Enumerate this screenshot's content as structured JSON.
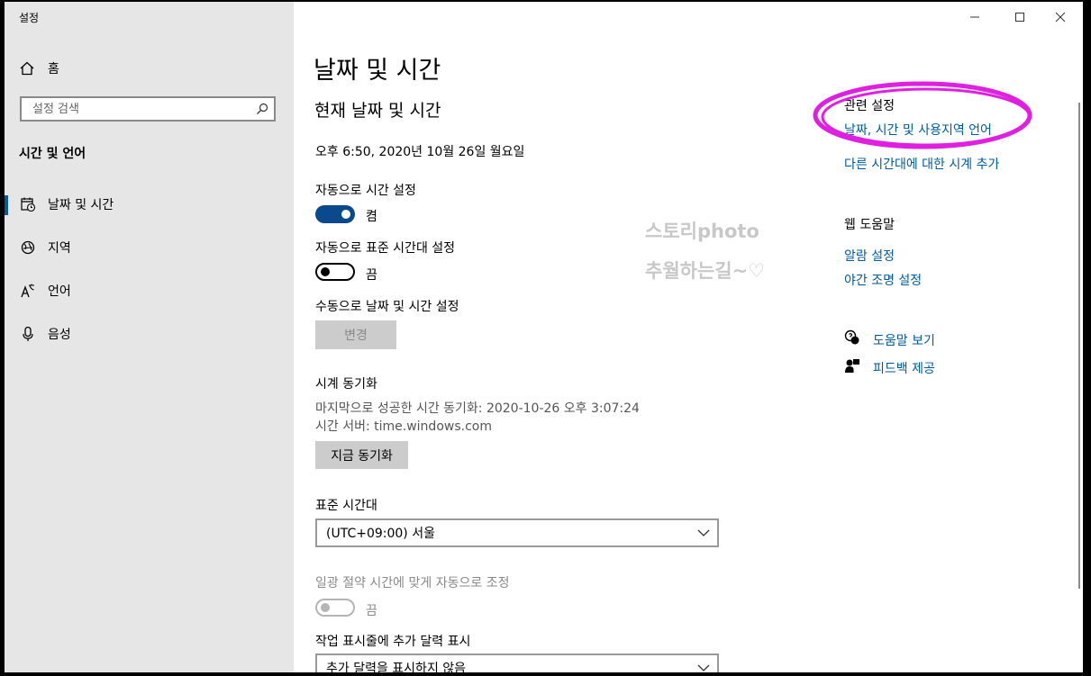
{
  "window": {
    "title": "설정"
  },
  "sidebar": {
    "home_label": "홈",
    "search_placeholder": "설정 검색",
    "section_title": "시간 및 언어",
    "items": [
      {
        "label": "날짜 및 시간",
        "icon": "date-time-icon",
        "active": true
      },
      {
        "label": "지역",
        "icon": "region-globe-icon"
      },
      {
        "label": "언어",
        "icon": "language-icon"
      },
      {
        "label": "음성",
        "icon": "microphone-icon"
      }
    ]
  },
  "main": {
    "title": "날짜 및 시간",
    "current_heading": "현재 날짜 및 시간",
    "current_datetime": "오후 6:50, 2020년 10월 26일 월요일",
    "auto_time": {
      "label": "자동으로 시간 설정",
      "state": "켬"
    },
    "auto_timezone": {
      "label": "자동으로 표준 시간대 설정",
      "state": "끔"
    },
    "manual": {
      "label": "수동으로 날짜 및 시간 설정",
      "button": "변경"
    },
    "sync": {
      "heading": "시계 동기화",
      "last_sync": "마지막으로 성공한 시간 동기화: 2020-10-26 오후 3:07:24",
      "server": "시간 서버: time.windows.com",
      "button": "지금 동기화"
    },
    "timezone": {
      "label": "표준 시간대",
      "value": "(UTC+09:00) 서울"
    },
    "dst": {
      "label": "일광 절약 시간에 맞게 자동으로 조정",
      "state": "끔"
    },
    "taskbar_calendar": {
      "label": "작업 표시줄에 추가 달력 표시",
      "value": "추가 달력을 표시하지 않음"
    }
  },
  "watermark": {
    "line1": "스토리photo",
    "line2": "추월하는길~♡"
  },
  "related": {
    "heading": "관련 설정",
    "links": [
      "날짜, 시간 및 사용지역 언어",
      "다른 시간대에 대한 시계 추가"
    ]
  },
  "web_help": {
    "heading": "웹 도움말",
    "links": [
      "알람 설정",
      "야간 조명 설정"
    ]
  },
  "help": {
    "get_help": "도움말 보기",
    "feedback": "피드백 제공"
  },
  "colors": {
    "accent": "#005a9e",
    "toggle_on": "#0a4a8c",
    "highlight_circle": "#e020e0"
  }
}
